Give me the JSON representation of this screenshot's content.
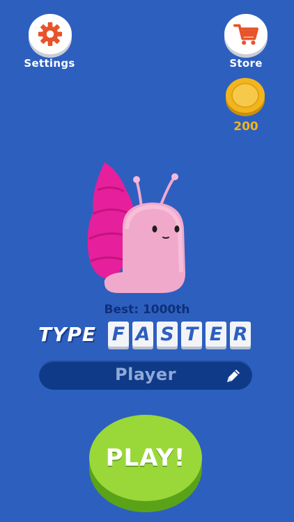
{
  "header": {
    "settings_label": "Settings",
    "store_label": "Store",
    "coins": "200"
  },
  "character": {
    "best_label": "Best: 1000th"
  },
  "logo": {
    "type_word": "TYPE",
    "faster_letters": [
      "F",
      "A",
      "S",
      "T",
      "E",
      "R"
    ]
  },
  "player": {
    "name": "Player"
  },
  "play": {
    "label": "PLAY!"
  },
  "colors": {
    "background": "#2d5fbf",
    "play_button": "#9ad83a",
    "coin": "#f2b51d",
    "name_field": "#0f3a87"
  }
}
